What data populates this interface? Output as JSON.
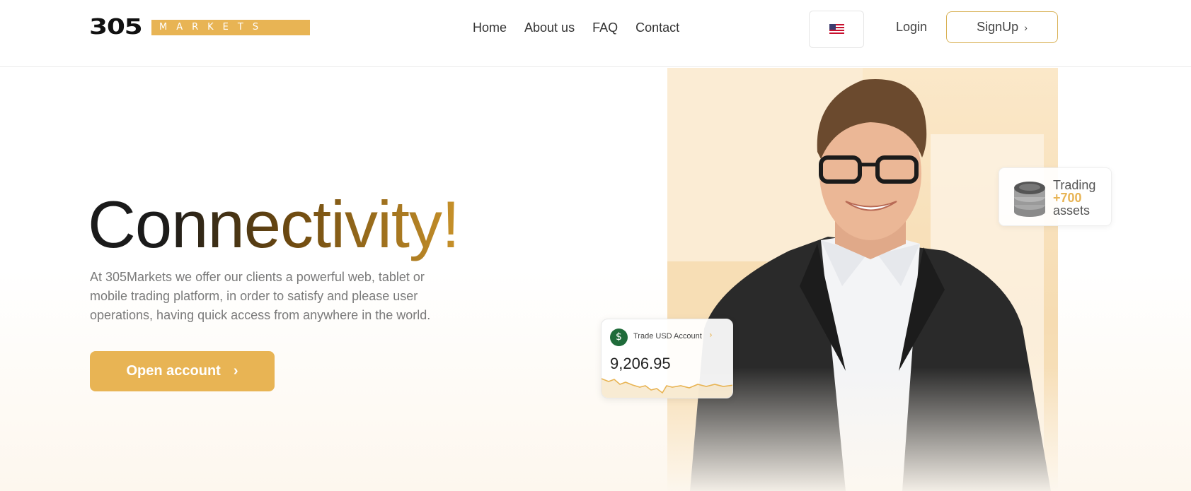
{
  "brand": {
    "number": "305",
    "word": "MARKETS"
  },
  "nav": {
    "items": [
      "Home",
      "About us",
      "FAQ",
      "Contact"
    ]
  },
  "header": {
    "login_label": "Login",
    "signup_label": "SignUp"
  },
  "hero": {
    "headline": "Connectivity!",
    "description": "At 305Markets we offer our clients a powerful web, tablet or mobile trading platform, in order to satisfy and please user operations, having quick access from anywhere in the world.",
    "cta_label": "Open account"
  },
  "trading_card": {
    "line1": "Trading",
    "highlight": "+700",
    "line3": "assets"
  },
  "account_card": {
    "currency_symbol": "$",
    "label": "Trade USD Account",
    "value": "9,206.95"
  },
  "colors": {
    "accent": "#e8b454",
    "hero_bg": "#f6dcb2",
    "account_icon": "#1f6b3a"
  },
  "icons": {
    "language": "us-flag-icon",
    "chevron": "chevron-right-icon",
    "coins": "coin-stack-icon"
  }
}
